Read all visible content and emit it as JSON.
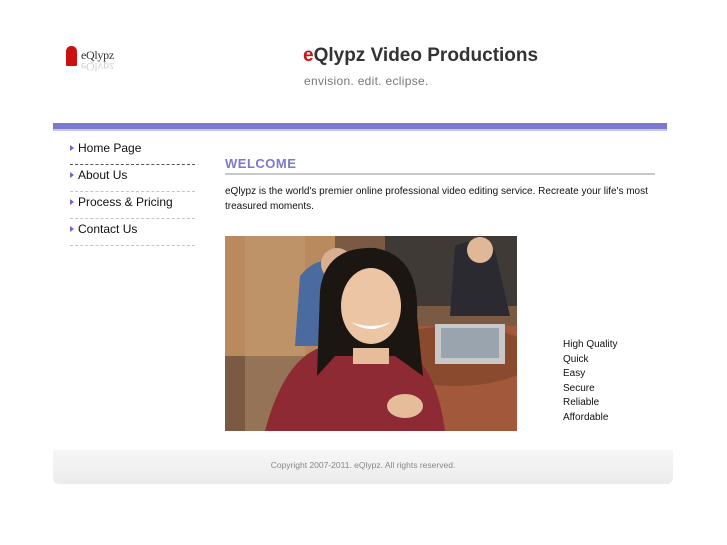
{
  "header": {
    "logo_text": "eQlypz",
    "title_accent": "e",
    "title_rest": "Qlypz Video Productions",
    "tagline": "envision. edit. eclipse."
  },
  "nav": {
    "items": [
      {
        "label": "Home Page"
      },
      {
        "label": "About Us"
      },
      {
        "label": "Process & Pricing"
      },
      {
        "label": "Contact Us"
      }
    ]
  },
  "main": {
    "heading": "WELCOME",
    "intro": "eQlypz is the world's premier online professional video editing service. Recreate your life's most treasured moments."
  },
  "features": [
    "High Quality",
    "Quick",
    "Easy",
    "Secure",
    "Reliable",
    "Affordable"
  ],
  "footer": {
    "copyright": "Copyright 2007-2011. eQlypz. All rights reserved."
  },
  "colors": {
    "accent": "#7b78cf",
    "brand_red": "#cc1111"
  }
}
